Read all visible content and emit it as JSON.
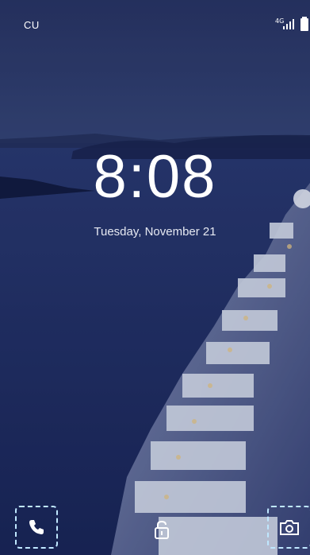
{
  "status_bar": {
    "carrier": "CU",
    "network_badge": "4G",
    "signal_icon": "signal-bars-icon",
    "battery_icon": "battery-icon"
  },
  "lock_screen": {
    "time": "8:08",
    "date": "Tuesday, November 21"
  },
  "shortcuts": {
    "left_icon": "phone-icon",
    "center_icon": "unlock-icon",
    "right_icon": "camera-icon",
    "highlight_color": "#bfe7ff"
  },
  "colors": {
    "sky_top": "#2c3a6a",
    "sea": "#1e2b63",
    "cliff_white": "#dfe6f3"
  }
}
